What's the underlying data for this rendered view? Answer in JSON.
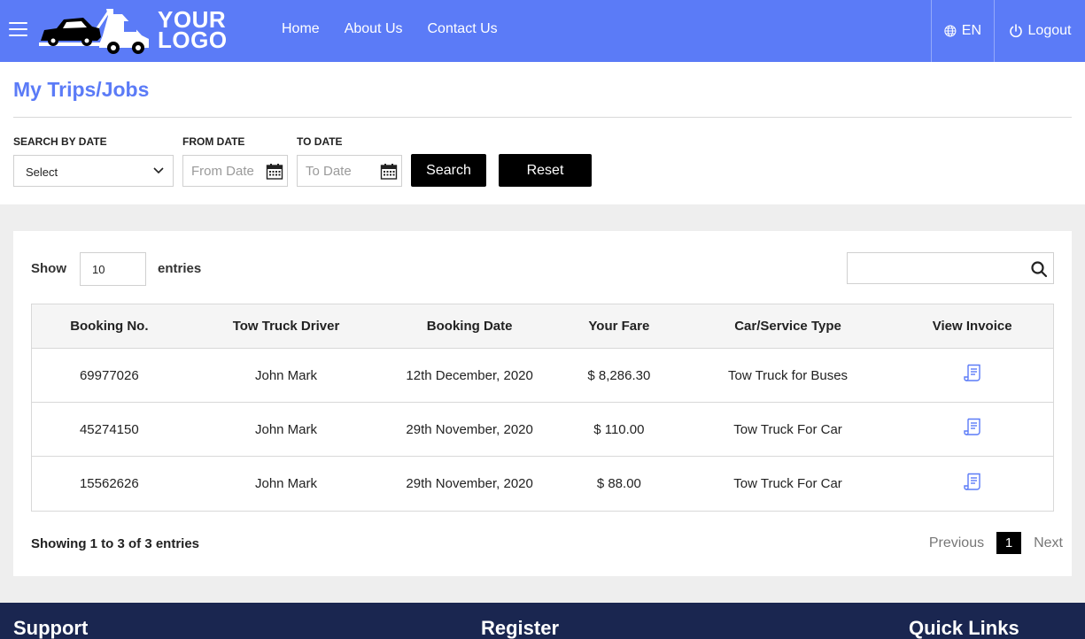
{
  "nav": {
    "logo_line1": "YOUR",
    "logo_line2": "LOGO",
    "links": [
      "Home",
      "About Us",
      "Contact Us"
    ],
    "language": "EN",
    "logout": "Logout"
  },
  "page": {
    "title": "My Trips/Jobs"
  },
  "filters": {
    "search_by_date_label": "SEARCH BY DATE",
    "search_by_date_value": "Select",
    "from_date_label": "FROM DATE",
    "from_date_placeholder": "From Date",
    "to_date_label": "TO DATE",
    "to_date_placeholder": "To Date",
    "search_button": "Search",
    "reset_button": "Reset"
  },
  "table_controls": {
    "show_label": "Show",
    "entries_value": "10",
    "entries_label": "entries"
  },
  "table": {
    "headers": [
      "Booking No.",
      "Tow Truck Driver",
      "Booking Date",
      "Your Fare",
      "Car/Service Type",
      "View Invoice"
    ],
    "rows": [
      [
        "69977026",
        "John Mark",
        "12th December, 2020",
        "$ 8,286.30",
        "Tow Truck for Buses"
      ],
      [
        "45274150",
        "John Mark",
        "29th November, 2020",
        "$ 110.00",
        "Tow Truck For Car"
      ],
      [
        "15562626",
        "John Mark",
        "29th November, 2020",
        "$ 88.00",
        "Tow Truck For Car"
      ]
    ]
  },
  "pagination": {
    "summary": "Showing 1 to 3 of 3 entries",
    "previous": "Previous",
    "current": "1",
    "next": "Next"
  },
  "footer": {
    "headings": [
      "Support",
      "Register",
      "Quick Links"
    ]
  },
  "colors": {
    "primary": "#5b7bf7",
    "footer": "#1a2650",
    "button": "#000000"
  }
}
